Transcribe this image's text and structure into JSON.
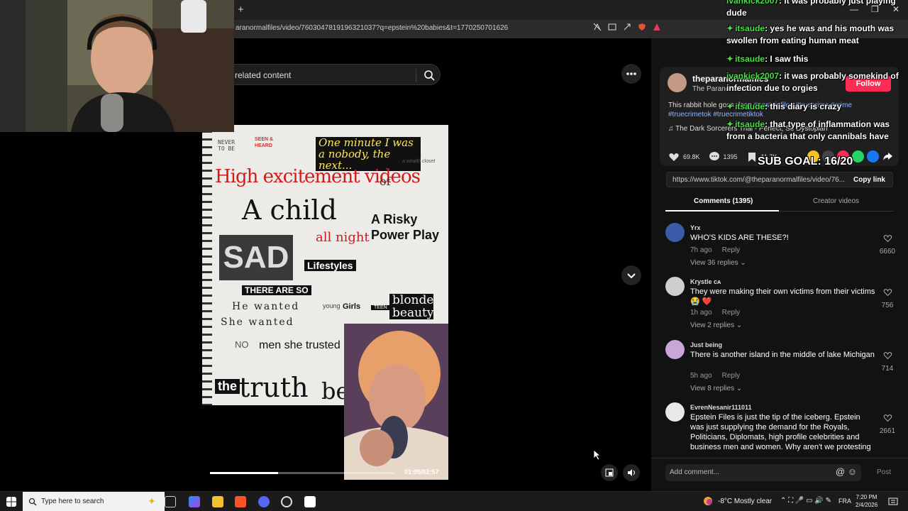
{
  "browser": {
    "new_tab_glyph": "+",
    "url": "aranormalfiles/video/7603047819196321037?q=epstein%20babies&t=1770250701626",
    "window_controls": [
      "—",
      "❐",
      "✕"
    ]
  },
  "search": {
    "text": "related content"
  },
  "video": {
    "time": "01:05/02:57",
    "progress": 0.37,
    "collage": {
      "never": "NEVER TO BE",
      "seen": "SEEN & HEARD",
      "minute": "One minute I was a nobody, the next...",
      "wealth": "a wealth closet",
      "high": "High excitement videos",
      "of": "of",
      "achild": "A child",
      "risky": "A Risky Power Play",
      "allnight": "all night",
      "sad": "SAD",
      "lifestyles": "Lifestyles",
      "therearso": "THERE ARE SO",
      "hewanted": "He wanted",
      "shewanted": "She wanted",
      "young": "young",
      "girls": "Girls",
      "teen": "TEEN",
      "blonde": "blonde beauty",
      "no": "NO",
      "men": "men she trusted",
      "the": "the",
      "the2": "the",
      "truth": "truth",
      "betr": "betr"
    }
  },
  "creator": {
    "name": "theparanormalfiles",
    "display": "The Paranormal Files",
    "follow": "Follow",
    "description": "This rabbit hole goes deep",
    "tags": "#epsteinfiles #truecrime #crime #truecrimetok #truecrimetiktok",
    "music": "The Dark Sorcerers Trial - Perfect, So Dystopian",
    "likes": "69.8K",
    "comments": "1395",
    "saves": "11.7K",
    "link": "https://www.tiktok.com/@theparanormalfiles/video/76...",
    "copy_link": "Copy link"
  },
  "tabs": {
    "comments": "Comments (1395)",
    "creator_videos": "Creator videos"
  },
  "comments": [
    {
      "user": "Yrx",
      "text": "WHO'S KIDS ARE THESE?!",
      "time": "7h ago",
      "reply": "Reply",
      "replies": "View 36 replies",
      "likes": "6660",
      "color": "#3b5aa8"
    },
    {
      "user": "Krystle ᴄᴀ",
      "text": "They were making their own victims from their victims 😭 ❤️",
      "time": "1h ago",
      "reply": "Reply",
      "replies": "View 2 replies",
      "likes": "756",
      "color": "#cfcfcf"
    },
    {
      "user": "Just being",
      "text": "There is another island in the middle of lake Michigan",
      "time": "5h ago",
      "reply": "Reply",
      "replies": "View 8 replies",
      "likes": "714",
      "color": "#c9a6d8"
    },
    {
      "user": "EvrenNesanir111011",
      "text": "Epstein Files is just the tip of the iceberg. Epstein was just supplying the demand for the Royals, Politicians, Diplomats, high profile celebrities and business men and women. Why aren't we protesting",
      "likes": "2661",
      "color": "#e8e8e8"
    }
  ],
  "comment_input": {
    "placeholder": "Add comment...",
    "icons": "@ ☺",
    "post": "Post"
  },
  "chat": {
    "lines": [
      {
        "user": "ivankick2007",
        "msg": ": it was probably just playing dude",
        "gem": false
      },
      {
        "user": "itsaude",
        "msg": ": yes he was and his mouth was swollen from eating human meat",
        "gem": true
      },
      {
        "user": "itsaude",
        "msg": ": I saw this",
        "gem": true
      },
      {
        "user": "ivankick2007",
        "msg": ": it was probably somekind of infection due to orgies",
        "gem": false
      },
      {
        "user": "itsaude",
        "msg": ": this diary is crazy",
        "gem": true
      },
      {
        "user": "itsaude",
        "msg": ": that type of inflammation was from a bacteria that only cannibals have",
        "gem": true
      }
    ],
    "sub_goal": "SUB GOAL: 16/20"
  },
  "taskbar": {
    "search_placeholder": "Type here to search",
    "weather": "-8°C  Mostly clear",
    "lang": "FRA",
    "time": "7:20 PM",
    "date": "2/4/2026"
  },
  "colors": {
    "accent": "#fe2c55",
    "chat_user": "#44e344",
    "tag": "#8cb4ff"
  }
}
